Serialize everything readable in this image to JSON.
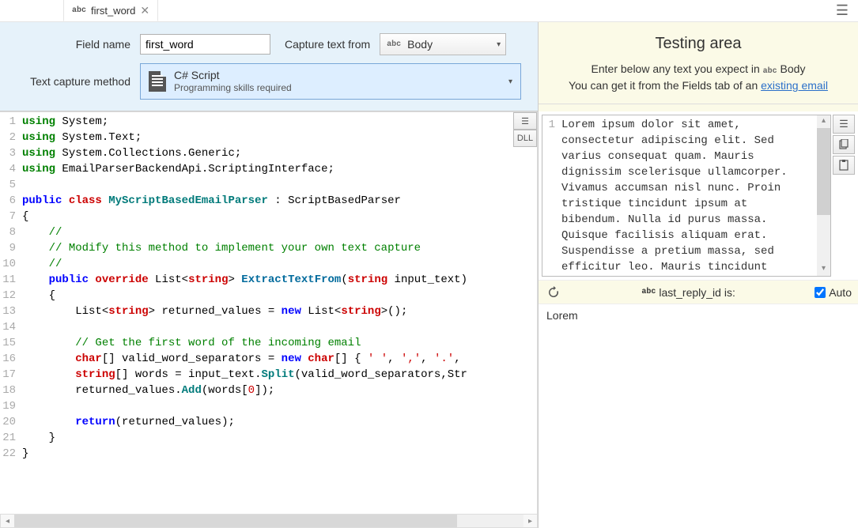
{
  "tab": {
    "prefix": "abc",
    "title": "first_word",
    "close": "✕"
  },
  "config": {
    "field_name_label": "Field name",
    "field_name_value": "first_word",
    "capture_from_label": "Capture text from",
    "capture_from_prefix": "abc",
    "capture_from_value": "Body",
    "method_label": "Text capture method",
    "method_main": "C# Script",
    "method_sub": "Programming skills required"
  },
  "code_buttons": {
    "menu": "☰",
    "dll": "DLL"
  },
  "code": {
    "lines": [
      {
        "n": 1,
        "segs": [
          {
            "c": "kw-using",
            "t": "using"
          },
          {
            "c": "plain",
            "t": " System;"
          }
        ]
      },
      {
        "n": 2,
        "segs": [
          {
            "c": "kw-using",
            "t": "using"
          },
          {
            "c": "plain",
            "t": " System.Text;"
          }
        ]
      },
      {
        "n": 3,
        "segs": [
          {
            "c": "kw-using",
            "t": "using"
          },
          {
            "c": "plain",
            "t": " System.Collections.Generic;"
          }
        ]
      },
      {
        "n": 4,
        "segs": [
          {
            "c": "kw-using",
            "t": "using"
          },
          {
            "c": "plain",
            "t": " EmailParserBackendApi.ScriptingInterface;"
          }
        ]
      },
      {
        "n": 5,
        "segs": [
          {
            "c": "plain",
            "t": ""
          }
        ]
      },
      {
        "n": 6,
        "segs": [
          {
            "c": "kw-blue",
            "t": "public "
          },
          {
            "c": "kw-red",
            "t": "class"
          },
          {
            "c": "identifier-teal",
            "t": " MyScriptBasedEmailParser"
          },
          {
            "c": "plain",
            "t": " : ScriptBasedParser"
          }
        ]
      },
      {
        "n": 7,
        "segs": [
          {
            "c": "plain",
            "t": "{"
          }
        ]
      },
      {
        "n": 8,
        "segs": [
          {
            "c": "plain",
            "t": "    "
          },
          {
            "c": "comment",
            "t": "//"
          }
        ]
      },
      {
        "n": 9,
        "segs": [
          {
            "c": "plain",
            "t": "    "
          },
          {
            "c": "comment",
            "t": "// Modify this method to implement your own text capture"
          }
        ]
      },
      {
        "n": 10,
        "segs": [
          {
            "c": "plain",
            "t": "    "
          },
          {
            "c": "comment",
            "t": "//"
          }
        ]
      },
      {
        "n": 11,
        "segs": [
          {
            "c": "plain",
            "t": "    "
          },
          {
            "c": "kw-blue",
            "t": "public "
          },
          {
            "c": "kw-red",
            "t": "override"
          },
          {
            "c": "plain",
            "t": " List<"
          },
          {
            "c": "kw-red",
            "t": "string"
          },
          {
            "c": "plain",
            "t": "> "
          },
          {
            "c": "method-def",
            "t": "ExtractTextFrom"
          },
          {
            "c": "plain",
            "t": "("
          },
          {
            "c": "kw-red",
            "t": "string"
          },
          {
            "c": "plain",
            "t": " input_text)"
          }
        ]
      },
      {
        "n": 12,
        "segs": [
          {
            "c": "plain",
            "t": "    {"
          }
        ]
      },
      {
        "n": 13,
        "segs": [
          {
            "c": "plain",
            "t": "        List<"
          },
          {
            "c": "kw-red",
            "t": "string"
          },
          {
            "c": "plain",
            "t": "> returned_values = "
          },
          {
            "c": "kw-blue",
            "t": "new"
          },
          {
            "c": "plain",
            "t": " List<"
          },
          {
            "c": "kw-red",
            "t": "string"
          },
          {
            "c": "plain",
            "t": ">();"
          }
        ]
      },
      {
        "n": 14,
        "segs": [
          {
            "c": "plain",
            "t": ""
          }
        ]
      },
      {
        "n": 15,
        "segs": [
          {
            "c": "plain",
            "t": "        "
          },
          {
            "c": "comment",
            "t": "// Get the first word of the incoming email"
          }
        ]
      },
      {
        "n": 16,
        "segs": [
          {
            "c": "plain",
            "t": "        "
          },
          {
            "c": "kw-red",
            "t": "char"
          },
          {
            "c": "plain",
            "t": "[] valid_word_separators = "
          },
          {
            "c": "kw-blue",
            "t": "new "
          },
          {
            "c": "kw-red",
            "t": "char"
          },
          {
            "c": "plain",
            "t": "[] { "
          },
          {
            "c": "str",
            "t": "' '"
          },
          {
            "c": "plain",
            "t": ", "
          },
          {
            "c": "str",
            "t": "','"
          },
          {
            "c": "plain",
            "t": ", "
          },
          {
            "c": "str",
            "t": "'.'"
          },
          {
            "c": "plain",
            "t": ","
          }
        ]
      },
      {
        "n": 17,
        "segs": [
          {
            "c": "plain",
            "t": "        "
          },
          {
            "c": "kw-red",
            "t": "string"
          },
          {
            "c": "plain",
            "t": "[] words = input_text."
          },
          {
            "c": "identifier-teal",
            "t": "Split"
          },
          {
            "c": "plain",
            "t": "(valid_word_separators,Str"
          }
        ]
      },
      {
        "n": 18,
        "segs": [
          {
            "c": "plain",
            "t": "        returned_values."
          },
          {
            "c": "identifier-teal",
            "t": "Add"
          },
          {
            "c": "plain",
            "t": "(words["
          },
          {
            "c": "str",
            "t": "0"
          },
          {
            "c": "plain",
            "t": "]);"
          }
        ]
      },
      {
        "n": 19,
        "segs": [
          {
            "c": "plain",
            "t": ""
          }
        ]
      },
      {
        "n": 20,
        "segs": [
          {
            "c": "plain",
            "t": "        "
          },
          {
            "c": "kw-blue",
            "t": "return"
          },
          {
            "c": "plain",
            "t": "(returned_values);"
          }
        ]
      },
      {
        "n": 21,
        "segs": [
          {
            "c": "plain",
            "t": "    }"
          }
        ]
      },
      {
        "n": 22,
        "segs": [
          {
            "c": "plain",
            "t": "}"
          }
        ]
      }
    ]
  },
  "testing": {
    "title": "Testing area",
    "line1_a": "Enter below any text you expect in ",
    "line1_prefix": "abc",
    "line1_b": " Body",
    "line2_a": "You can get it from the Fields tab of an ",
    "line2_link": "existing email",
    "sample_gutter": "1",
    "sample_text": "Lorem ipsum dolor sit amet, consectetur adipiscing elit. Sed varius consequat quam. Mauris dignissim scelerisque ullamcorper. Vivamus accumsan nisl nunc. Proin tristique tincidunt ipsum at bibendum. Nulla id purus massa. Quisque facilisis aliquam erat. Suspendisse a pretium massa, sed efficitur leo. Mauris tincidunt pellentesque neque, eget tristique",
    "result_prefix": "abc",
    "result_label": "last_reply_id is:",
    "auto_label": "Auto",
    "auto_checked": true,
    "result_output": "Lorem"
  }
}
